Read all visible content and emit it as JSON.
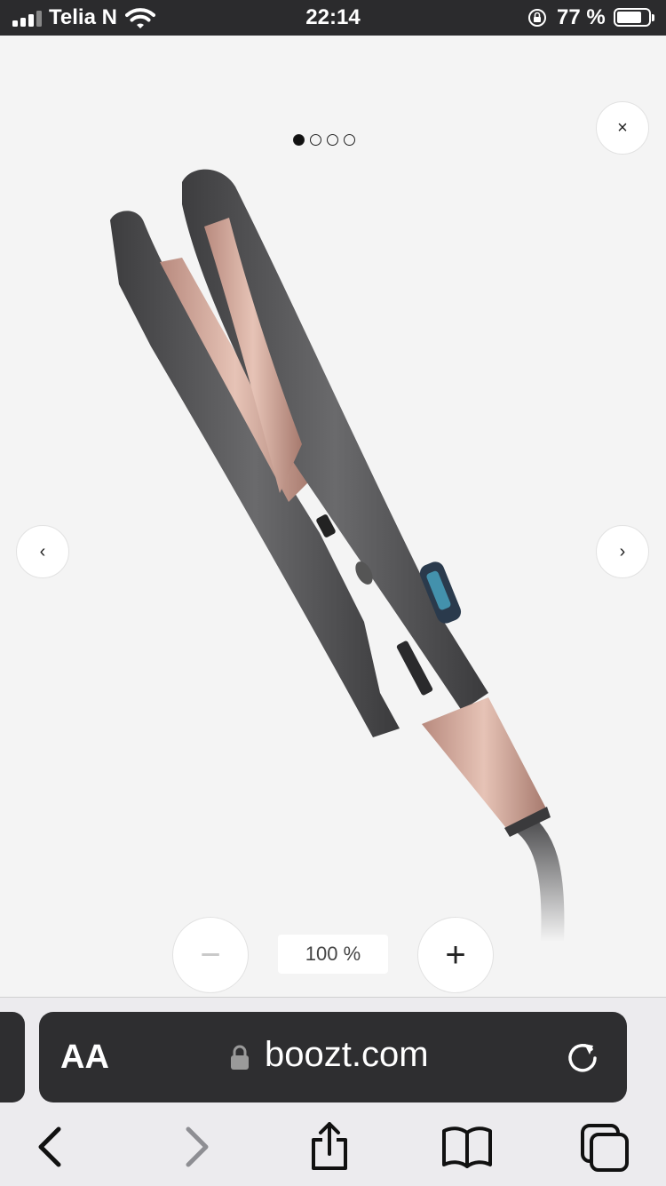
{
  "status_bar": {
    "carrier": "Telia N",
    "time": "22:14",
    "battery": "77 %"
  },
  "viewer": {
    "page_indicator": {
      "count": 4,
      "active": 0
    },
    "close_label": "×",
    "prev_label": "‹",
    "next_label": "›",
    "zoom_out_label": "−",
    "zoom_in_label": "+",
    "zoom_level": "100 %"
  },
  "browser": {
    "text_size_label": "AA",
    "url": "boozt.com"
  }
}
